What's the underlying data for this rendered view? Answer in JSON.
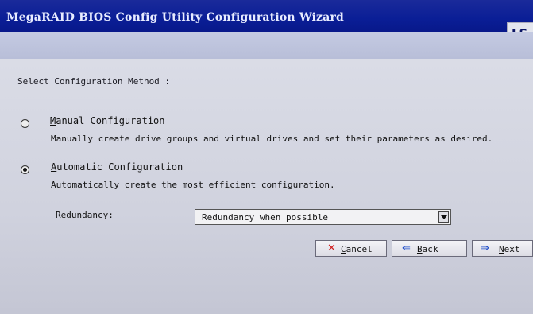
{
  "window": {
    "title": "MegaRAID BIOS Config Utility Configuration Wizard",
    "logo_text": "LS"
  },
  "heading": "Select Configuration Method :",
  "options": [
    {
      "label": "Manual Configuration",
      "label_hotkey": "M",
      "label_rest": "anual Configuration",
      "description": "Manually create drive groups and virtual drives and set their parameters as desired.",
      "selected": false
    },
    {
      "label": "Automatic Configuration",
      "label_hotkey": "A",
      "label_rest": "utomatic Configuration",
      "description": "Automatically create the most efficient configuration.",
      "selected": true
    }
  ],
  "redundancy": {
    "label": "Redundancy:",
    "label_hotkey": "R",
    "label_rest": "edundancy:",
    "value": "Redundancy when possible"
  },
  "buttons": {
    "cancel": {
      "hotkey": "C",
      "rest": "ancel",
      "icon": "x-icon"
    },
    "back": {
      "hotkey": "B",
      "rest": "ack",
      "icon": "arrow-left-icon"
    },
    "next": {
      "hotkey": "N",
      "rest": "ext",
      "icon": "arrow-right-icon"
    }
  },
  "colors": {
    "titlebar": "#0a1e96",
    "cancel_icon": "#d02020",
    "nav_icon": "#1848c8"
  }
}
